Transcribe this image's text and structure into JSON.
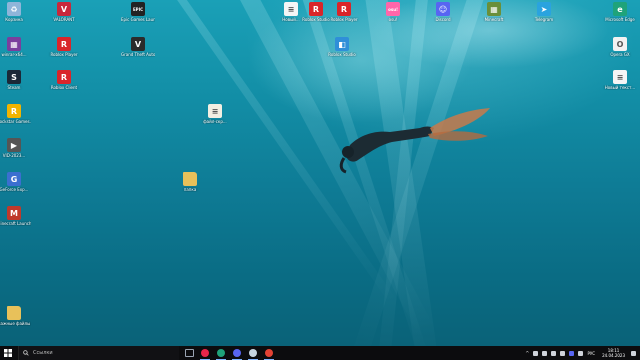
{
  "desktop": {
    "icons": [
      {
        "id": "recycle-bin",
        "label": "Корзина",
        "icon": "recycle-bin-icon",
        "color": "#8fb5d9",
        "glyph": "♻"
      },
      {
        "id": "valorant",
        "label": "VALORANT",
        "icon": "valorant-icon",
        "color": "#c8283c",
        "glyph": "V"
      },
      {
        "id": "epic",
        "label": "Epic Games Launcher",
        "icon": "epic-games-icon",
        "color": "#222222",
        "glyph": "EPIC"
      },
      {
        "id": "winrar",
        "label": "winrar-x64...",
        "icon": "winrar-icon",
        "color": "#7a3e9d",
        "glyph": "▦"
      },
      {
        "id": "roblox-player",
        "label": "Roblox Player",
        "icon": "roblox-icon",
        "color": "#d9252a",
        "glyph": "R"
      },
      {
        "id": "gta5",
        "label": "Grand Theft Auto V",
        "icon": "gta-icon",
        "color": "#2b2b2b",
        "glyph": "V"
      },
      {
        "id": "steam",
        "label": "Steam",
        "icon": "steam-icon",
        "color": "#1b2838",
        "glyph": "S"
      },
      {
        "id": "roblox-client",
        "label": "Roblox Client",
        "icon": "roblox-icon",
        "color": "#d9252a",
        "glyph": "R"
      },
      {
        "id": "rockstar",
        "label": "Rockstar Games...",
        "icon": "rockstar-icon",
        "color": "#f2b400",
        "glyph": "R"
      },
      {
        "id": "vid",
        "label": "VID-2023...",
        "icon": "video-file-icon",
        "color": "#555555",
        "glyph": "▶"
      },
      {
        "id": "geforce",
        "label": "GeForce Exp...",
        "icon": "geforce-icon",
        "color": "#3b6fd0",
        "glyph": "G"
      },
      {
        "id": "mcpe",
        "label": "Minecraft Launcher",
        "icon": "launcher-icon",
        "color": "#c0392b",
        "glyph": "M"
      },
      {
        "id": "important",
        "label": "Важные файлы",
        "icon": "folder-icon",
        "color": "#e8c15a",
        "glyph": ""
      },
      {
        "id": "script-file",
        "label": "файл-скр...",
        "icon": "document-icon",
        "color": "#f3efe2",
        "glyph": "≡"
      },
      {
        "id": "folder-new",
        "label": "папка",
        "icon": "folder-icon",
        "color": "#e8c15a",
        "glyph": ""
      },
      {
        "id": "notepad",
        "label": "Новый...",
        "icon": "text-file-icon",
        "color": "#f5f5f5",
        "glyph": "≡"
      },
      {
        "id": "roblox-studio-top",
        "label": "Roblox Studio",
        "icon": "roblox-icon",
        "color": "#d9252a",
        "glyph": "R"
      },
      {
        "id": "roblox-player-top",
        "label": "Roblox Player",
        "icon": "roblox-icon",
        "color": "#d9252a",
        "glyph": "R"
      },
      {
        "id": "osu",
        "label": "osu!",
        "icon": "osu-icon",
        "color": "#ff66aa",
        "glyph": "osu!"
      },
      {
        "id": "discord",
        "label": "Discord",
        "icon": "discord-icon",
        "color": "#5865f2",
        "glyph": "☺"
      },
      {
        "id": "minecraft",
        "label": "Minecraft",
        "icon": "minecraft-icon",
        "color": "#6a8f3a",
        "glyph": "▦"
      },
      {
        "id": "telegram",
        "label": "Telegram",
        "icon": "telegram-icon",
        "color": "#2aa3df",
        "glyph": "➤"
      },
      {
        "id": "edge",
        "label": "Microsoft Edge",
        "icon": "edge-icon",
        "color": "#1fa37a",
        "glyph": "e"
      },
      {
        "id": "opera",
        "label": "Opera GX",
        "icon": "opera-icon",
        "color": "#f2f2f2",
        "glyph": "O"
      },
      {
        "id": "roblox-studio",
        "label": "Roblox Studio",
        "icon": "roblox-studio-icon",
        "color": "#2f8fd8",
        "glyph": "◧"
      },
      {
        "id": "textdoc",
        "label": "Новый текст...",
        "icon": "text-file-icon",
        "color": "#f5f5f5",
        "glyph": "≡"
      }
    ]
  },
  "taskbar": {
    "search_placeholder": "Ссылки",
    "apps": [
      {
        "name": "task-view",
        "color": "#9aa4b2"
      },
      {
        "name": "opera-gx",
        "color": "#e8254a"
      },
      {
        "name": "edge",
        "color": "#1fa37a"
      },
      {
        "name": "discord",
        "color": "#5865f2"
      },
      {
        "name": "steam",
        "color": "#c7d5e0"
      },
      {
        "name": "yandex",
        "color": "#e34234"
      }
    ],
    "language": "РУС",
    "time": "18:11",
    "date": "24.04.2023"
  }
}
